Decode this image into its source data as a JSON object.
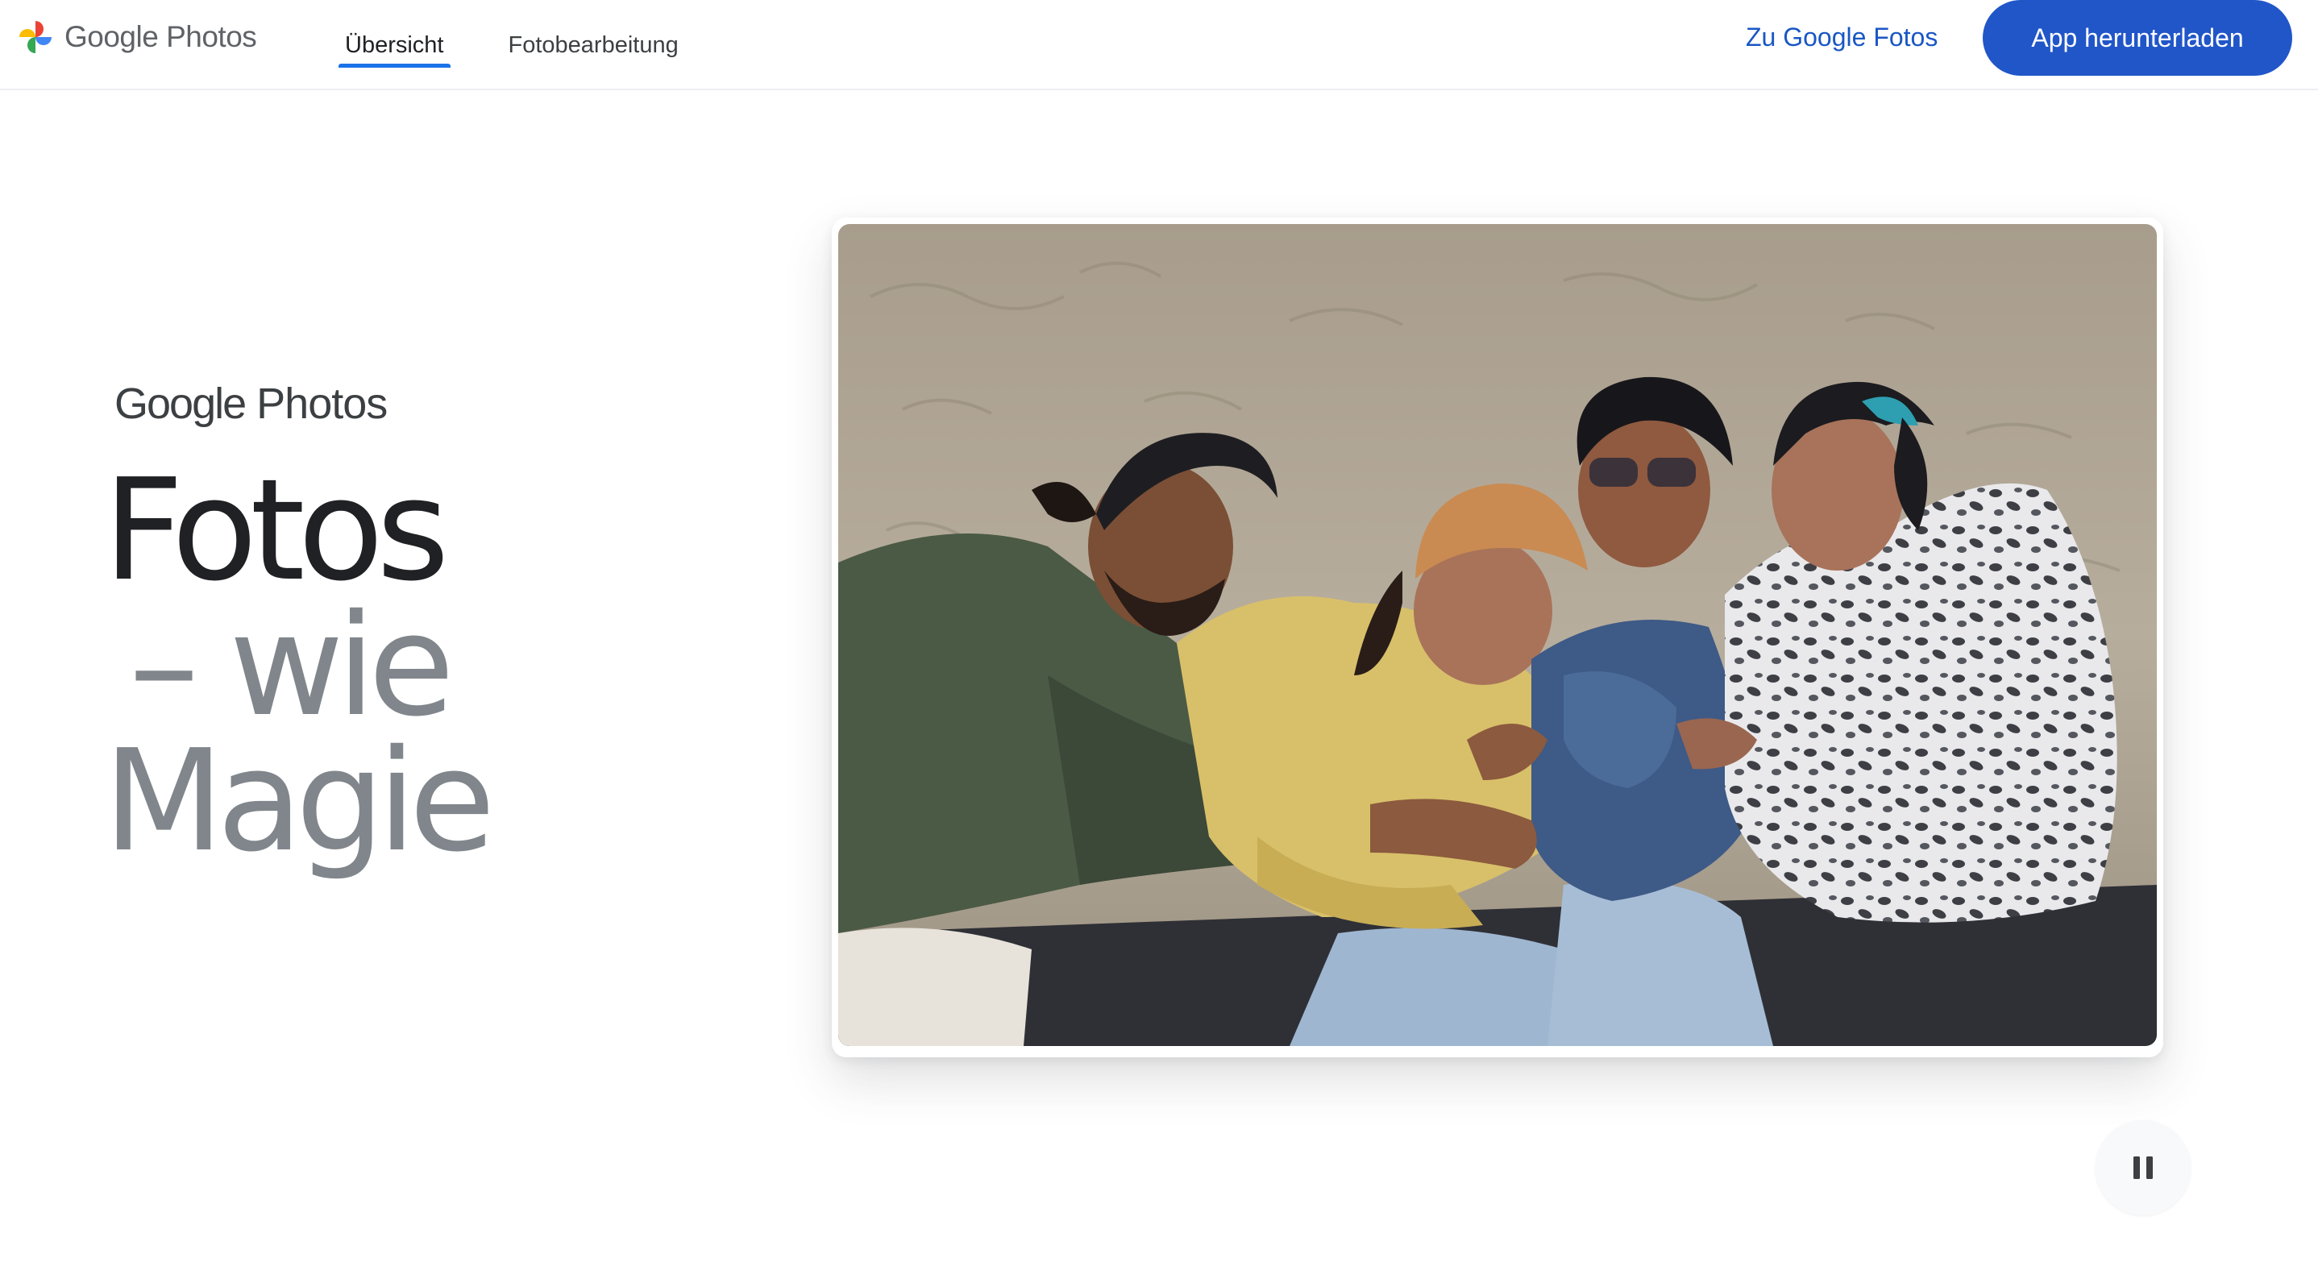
{
  "header": {
    "brand": {
      "google": "Google",
      "product": "Photos",
      "icon": "google-photos-pinwheel-icon"
    },
    "tabs": [
      {
        "label": "Übersicht",
        "active": true
      },
      {
        "label": "Fotobearbeitung",
        "active": false
      }
    ],
    "go_to_photos_link": "Zu Google Fotos",
    "download_button": "App herunterladen"
  },
  "hero": {
    "logo": {
      "google": "Google",
      "product": "Photos"
    },
    "headline": {
      "line1": "Fotos",
      "line2": "– wie",
      "line3": "Magie"
    }
  },
  "media": {
    "photo_icon": "group-photo-on-beach",
    "pause_icon": "pause-icon"
  },
  "colors": {
    "accent_blue": "#1a73e8",
    "cta_blue": "#2156c9",
    "link_blue": "#1a57c4",
    "headline_dark": "#202124",
    "headline_grey": "#80868b"
  }
}
